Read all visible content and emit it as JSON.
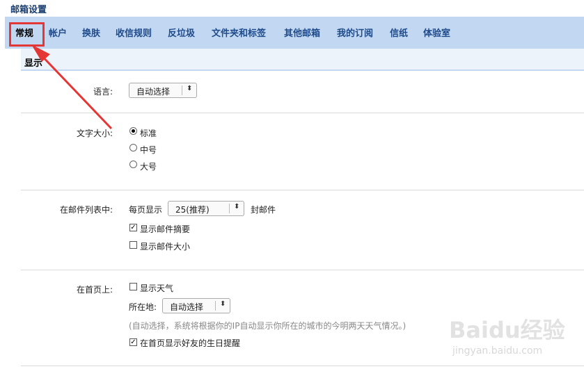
{
  "page_title": "邮箱设置",
  "tabs": [
    "常规",
    "帐户",
    "换肤",
    "收信规则",
    "反垃圾",
    "文件夹和标签",
    "其他邮箱",
    "我的订阅",
    "信纸",
    "体验室"
  ],
  "section": {
    "title": "显示"
  },
  "language": {
    "label": "语言:",
    "value": "自动选择"
  },
  "font_size": {
    "label": "文字大小:",
    "options": [
      "标准",
      "中号",
      "大号"
    ],
    "selected": "标准"
  },
  "mail_list": {
    "label": "在邮件列表中:",
    "per_page_prefix": "每页显示",
    "per_page_value": "25(推荐)",
    "per_page_suffix": "封邮件",
    "show_summary": {
      "label": "显示邮件摘要",
      "checked": true
    },
    "show_size": {
      "label": "显示邮件大小",
      "checked": false
    }
  },
  "homepage": {
    "label": "在首页上:",
    "show_weather": {
      "label": "显示天气",
      "checked": false
    },
    "location_label": "所在地:",
    "location_value": "自动选择",
    "hint": "(自动选择，系统将根据你的IP自动显示你所在的城市的今明两天天气情况。)",
    "birthday": {
      "label": "在首页显示好友的生日提醒",
      "checked": true
    }
  },
  "watermark": {
    "logo": "Baidu经验",
    "url": "jingyan.baidu.com"
  },
  "colors": {
    "tab_bar": "#c2d8f2",
    "annotation": "#e53636",
    "tab_text": "#1f4a8a"
  }
}
